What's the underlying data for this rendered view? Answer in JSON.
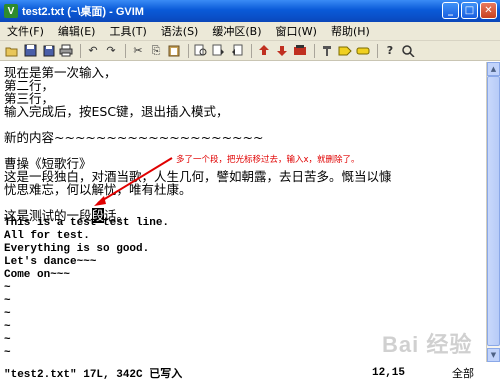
{
  "window": {
    "title": "test2.txt (~\\桌面) - GVIM",
    "app_icon": "vim-icon",
    "buttons": [
      "minimize",
      "maximize",
      "close"
    ]
  },
  "menu": [
    "文件(F)",
    "编辑(E)",
    "工具(T)",
    "语法(S)",
    "缓冲区(B)",
    "窗口(W)",
    "帮助(H)"
  ],
  "toolbar": {
    "icons": [
      "open-icon",
      "save-icon",
      "save-all-icon",
      "print-icon",
      "undo-icon",
      "redo-icon",
      "cut-icon",
      "copy-icon",
      "paste-icon",
      "find-replace-icon",
      "find-next-icon",
      "find-prev-icon",
      "load-session-icon",
      "save-session-icon",
      "run-script-icon",
      "make-icon",
      "build-tags-icon",
      "jump-tag-icon",
      "help-icon",
      "find-help-icon"
    ]
  },
  "editor": {
    "lines": [
      "现在是第一次输入，",
      "第二行，",
      "第三行，",
      "输入完成后，按ESC键，退出插入模式，",
      "",
      "新的内容~~~~~~~~~~~~~~~~~~~~",
      "",
      "曹操《短歌行》",
      "这是一段独白，对酒当歌，人生几何，譬如朝露，去日苦多。慨当以慷",
      "忧思难忘，何以解忧，唯有杜康。",
      "",
      "这是测试的一段",
      "This is a test test line.",
      "All for test.",
      "Everything is so good.",
      "Let's dance~~~",
      "Come on~~~"
    ],
    "cursor_char": "段",
    "cursor_line_suffix": "话。",
    "empty_marker": "~"
  },
  "annotation": "多了一个段，把光标移过去，输入x，就删除了。",
  "status": {
    "message": "\"test2.txt\" 17L, 342C 已写入",
    "position": "12,15",
    "scroll": "全部"
  },
  "watermark": "Bai 经验",
  "colors": {
    "titlebar": "#0a5ad8",
    "annotation": "#e00000",
    "chrome": "#ece9d8"
  }
}
